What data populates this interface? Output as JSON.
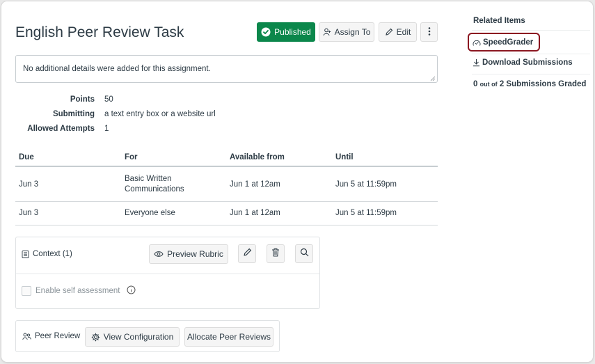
{
  "header": {
    "title": "English Peer Review Task",
    "published_label": "Published",
    "assign_to_label": "Assign To",
    "edit_label": "Edit"
  },
  "details": {
    "text": "No additional details were added for this assignment."
  },
  "meta": {
    "points_label": "Points",
    "points_value": "50",
    "submitting_label": "Submitting",
    "submitting_value": "a text entry box or a website url",
    "attempts_label": "Allowed Attempts",
    "attempts_value": "1"
  },
  "dates_table": {
    "headers": [
      "Due",
      "For",
      "Available from",
      "Until"
    ],
    "rows": [
      [
        "Jun 3",
        "Basic Written Communications",
        "Jun 1 at 12am",
        "Jun 5 at 11:59pm"
      ],
      [
        "Jun 3",
        "Everyone else",
        "Jun 1 at 12am",
        "Jun 5 at 11:59pm"
      ]
    ]
  },
  "rubric": {
    "context_label": "Context (1)",
    "preview_label": "Preview Rubric",
    "self_assessment_label": "Enable self assessment"
  },
  "peer_review": {
    "label": "Peer Review",
    "view_config_label": "View Configuration",
    "allocate_label": "Allocate Peer Reviews"
  },
  "sidebar": {
    "heading": "Related Items",
    "speedgrader_label": "SpeedGrader",
    "download_label": "Download Submissions",
    "graded_count": "0",
    "graded_mid": "out of",
    "graded_rest": "2 Submissions Graded"
  },
  "colors": {
    "published_green": "#0b874b",
    "highlight_red": "#8b1620",
    "text": "#2d3b45"
  }
}
